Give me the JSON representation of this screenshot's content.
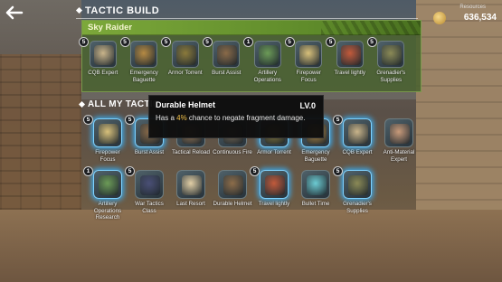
{
  "header": {
    "title": "TACTIC BUILD"
  },
  "resources": {
    "label": "Resources",
    "value": "636,534"
  },
  "build": {
    "name": "Sky Raider",
    "items": [
      {
        "label": "CQB Expert",
        "level": "5",
        "color": "#c9b48a"
      },
      {
        "label": "Emergency Baguette",
        "level": "5",
        "color": "#b68a43"
      },
      {
        "label": "Armor Torrent",
        "level": "5",
        "color": "#8b7a3b"
      },
      {
        "label": "Burst Assist",
        "level": "5",
        "color": "#8a6a48"
      },
      {
        "label": "Artillery Operations",
        "level": "1",
        "color": "#6c9b57"
      },
      {
        "label": "Firepower Focus",
        "level": "5",
        "color": "#d8c07a"
      },
      {
        "label": "Travel lightly",
        "level": "5",
        "color": "#c25a3b"
      },
      {
        "label": "Grenadier's Supplies",
        "level": "5",
        "color": "#8b8a56"
      }
    ]
  },
  "all_tactics": {
    "title": "ALL MY TACTIC",
    "row1": [
      {
        "label": "Firepower Focus",
        "level": "5",
        "color": "#d8c07a",
        "glow": true
      },
      {
        "label": "Burst Assist",
        "level": "5",
        "color": "#8a6a48",
        "glow": true
      },
      {
        "label": "Tactical Reload",
        "level": "",
        "color": "#9c7a58",
        "glow": false
      },
      {
        "label": "Continuous Fire",
        "level": "",
        "color": "#7a6b56",
        "glow": false
      },
      {
        "label": "Armor Torrent",
        "level": "",
        "color": "#8b7a3b",
        "glow": true
      },
      {
        "label": "Emergency Baguette",
        "level": "",
        "color": "#b68a43",
        "glow": true
      },
      {
        "label": "CQB Expert",
        "level": "5",
        "color": "#c9b48a",
        "glow": true
      },
      {
        "label": "Anti-Material Expert",
        "level": "",
        "color": "#c89a7a",
        "glow": false
      }
    ],
    "row2": [
      {
        "label": "Artillery Operations Research",
        "level": "1",
        "color": "#6c9b57",
        "glow": true
      },
      {
        "label": "War Tactics Class",
        "level": "5",
        "color": "#4a4f76",
        "glow": false
      },
      {
        "label": "Last Resort",
        "level": "",
        "color": "#e2cfa6",
        "glow": false
      },
      {
        "label": "Durable Helmet",
        "level": "",
        "color": "#8d6d4a",
        "glow": false
      },
      {
        "label": "Travel lightly",
        "level": "5",
        "color": "#c25a3b",
        "glow": true
      },
      {
        "label": "Bullet Time",
        "level": "",
        "color": "#6ccbd3",
        "glow": false
      },
      {
        "label": "Grenadier's Supplies",
        "level": "5",
        "color": "#8b8a56",
        "glow": true
      }
    ]
  },
  "tooltip": {
    "name": "Durable Helmet",
    "level": "LV.0",
    "desc_prefix": "Has a ",
    "desc_highlight": "4%",
    "desc_suffix": " chance to negate fragment damage."
  },
  "colors": {
    "build_panel": "#4a6230",
    "build_header": "#7ca83a",
    "glow": "#3fa4e0",
    "highlight": "#f3c24a"
  }
}
